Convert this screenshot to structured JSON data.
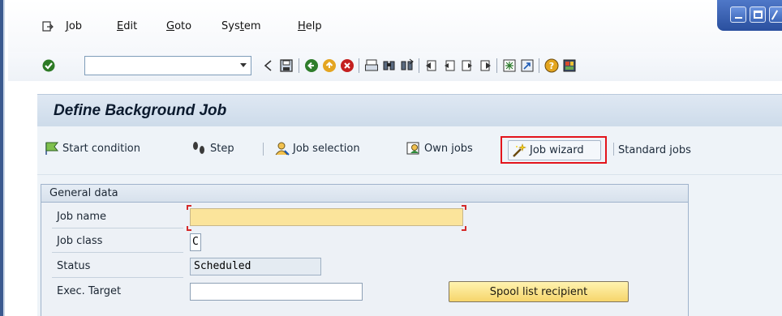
{
  "menubar": {
    "items": [
      {
        "label": "Job",
        "accel": "J",
        "rest": "ob"
      },
      {
        "label": "Edit",
        "accel": "E",
        "rest": "dit"
      },
      {
        "label": "Goto",
        "accel": "G",
        "rest": "oto"
      },
      {
        "label": "System",
        "accel": "",
        "pre": "Sys",
        "accel2": "t",
        "rest": "em"
      },
      {
        "label": "Help",
        "accel": "H",
        "rest": "elp"
      }
    ]
  },
  "systoolbar": {
    "command_field_value": ""
  },
  "screen": {
    "title": "Define Background Job"
  },
  "apptoolbar": {
    "start_condition": "Start condition",
    "step": "Step",
    "job_selection": "Job selection",
    "own_jobs": "Own jobs",
    "job_wizard": "Job wizard",
    "standard_jobs": "Standard jobs"
  },
  "general_data": {
    "title": "General data",
    "job_name_label": "Job name",
    "job_name_value": "",
    "job_class_label": "Job class",
    "job_class_value": "C",
    "status_label": "Status",
    "status_value": "Scheduled",
    "exec_target_label": "Exec. Target",
    "exec_target_value": "",
    "spool_button": "Spool list recipient"
  },
  "colors": {
    "required_field": "#fbe49b",
    "highlight": "#e3141b",
    "title_bar": "#cddbea"
  }
}
